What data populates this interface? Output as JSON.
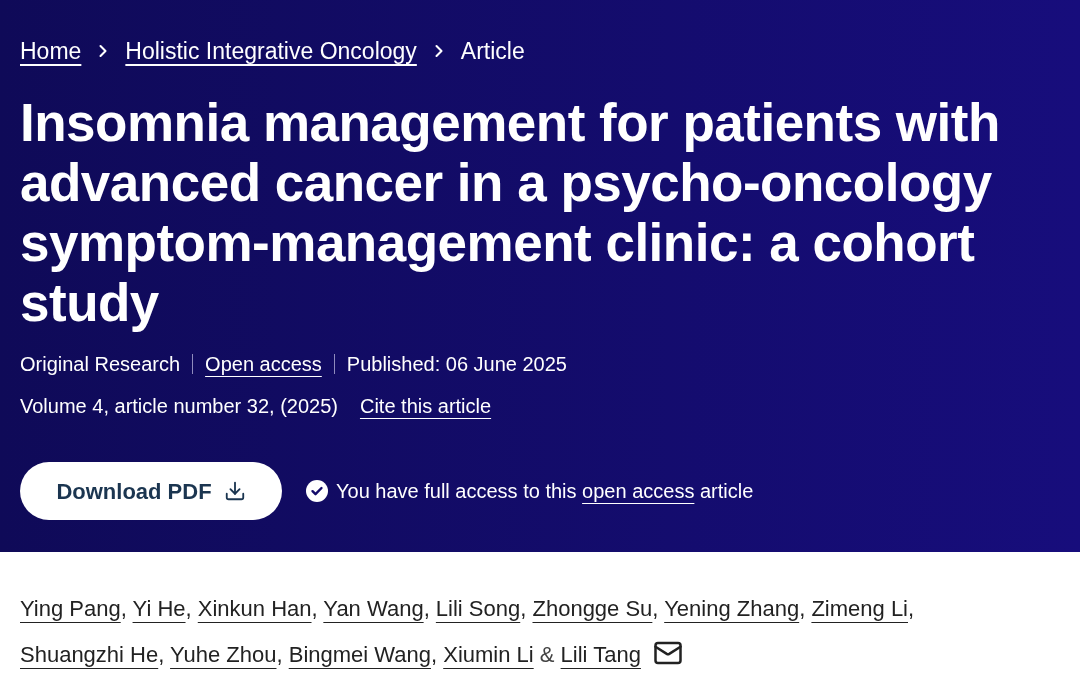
{
  "breadcrumb": [
    {
      "label": "Home",
      "link": true
    },
    {
      "label": "Holistic Integrative Oncology",
      "link": true
    },
    {
      "label": "Article",
      "link": false
    }
  ],
  "title": "Insomnia management for patients with advanced cancer in a psycho-oncology symptom-management clinic: a cohort study",
  "meta": {
    "items": [
      {
        "text": "Original Research",
        "link": false
      },
      {
        "text": "Open access",
        "link": true
      },
      {
        "text": "Published: 06 June 2025",
        "link": false
      }
    ],
    "citation": "Volume 4, article number 32, (2025)",
    "cite_link": "Cite this article"
  },
  "download_button": {
    "label": "Download PDF"
  },
  "access_note": {
    "before": "You have full access to this",
    "link": "open access",
    "after": "article"
  },
  "authors": {
    "separator": ",",
    "last_separator": "&",
    "items": [
      {
        "name": "Ying Pang",
        "corresponding": false
      },
      {
        "name": "Yi He",
        "corresponding": false
      },
      {
        "name": "Xinkun Han",
        "corresponding": false
      },
      {
        "name": "Yan Wang",
        "corresponding": false
      },
      {
        "name": "Lili Song",
        "corresponding": false
      },
      {
        "name": "Zhongge Su",
        "corresponding": false
      },
      {
        "name": "Yening Zhang",
        "corresponding": false
      },
      {
        "name": "Zimeng Li",
        "corresponding": false
      },
      {
        "name": "Shuangzhi He",
        "corresponding": false
      },
      {
        "name": "Yuhe Zhou",
        "corresponding": false
      },
      {
        "name": "Bingmei Wang",
        "corresponding": false
      },
      {
        "name": "Xiumin Li",
        "corresponding": false
      },
      {
        "name": "Lili Tang",
        "corresponding": true
      }
    ]
  }
}
